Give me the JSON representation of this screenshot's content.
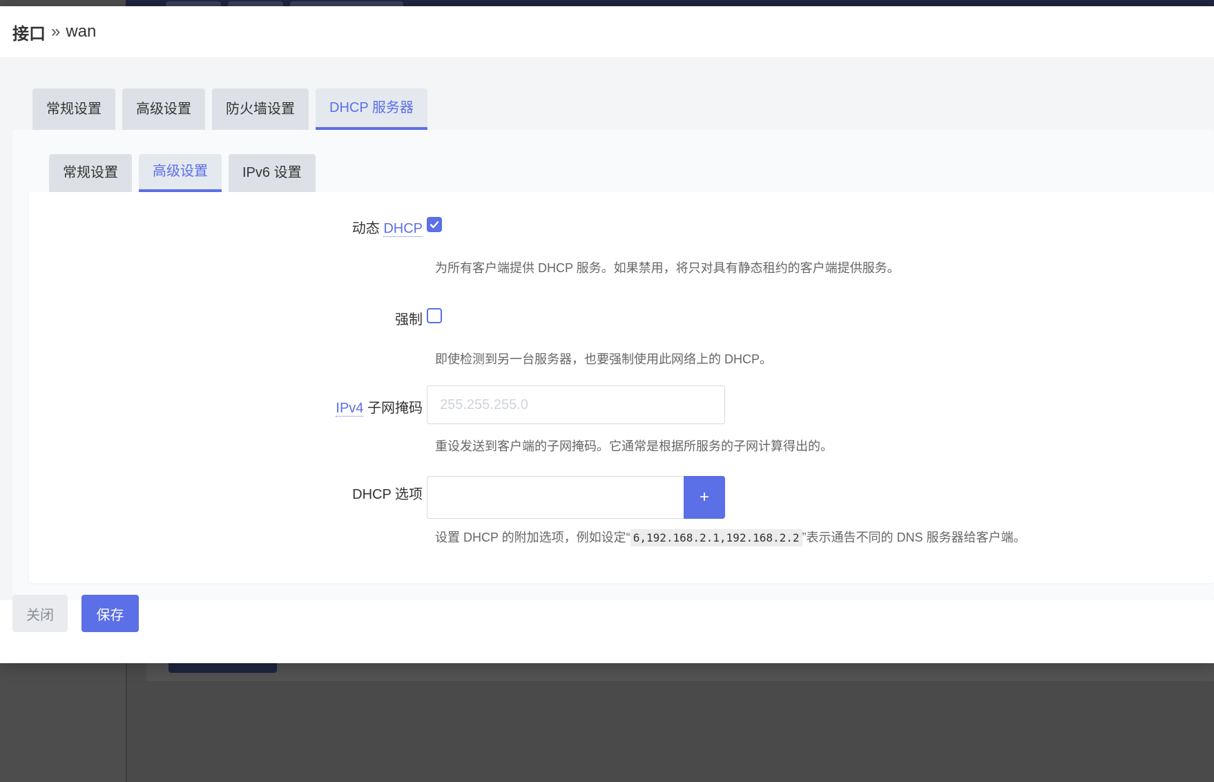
{
  "header": {
    "breadcrumb_root": "接口",
    "breadcrumb_sep": "»",
    "breadcrumb_current": "wan"
  },
  "outer_tabs": [
    {
      "label": "常规设置",
      "active": false
    },
    {
      "label": "高级设置",
      "active": false
    },
    {
      "label": "防火墙设置",
      "active": false
    },
    {
      "label": "DHCP 服务器",
      "active": true
    }
  ],
  "inner_tabs": [
    {
      "label": "常规设置",
      "active": false
    },
    {
      "label": "高级设置",
      "active": true
    },
    {
      "label": "IPv6 设置",
      "active": false
    }
  ],
  "fields": {
    "dynamic_dhcp": {
      "label_prefix": "动态",
      "label_abbr": "DHCP",
      "checked": true,
      "description": "为所有客户端提供 DHCP 服务。如果禁用，将只对具有静态租约的客户端提供服务。"
    },
    "force": {
      "label": "强制",
      "checked": false,
      "description": "即使检测到另一台服务器，也要强制使用此网络上的 DHCP。"
    },
    "netmask": {
      "label_abbr": "IPv4",
      "label_suffix": "子网掩码",
      "value": "",
      "placeholder": "255.255.255.0",
      "description": "重设发送到客户端的子网掩码。它通常是根据所服务的子网计算得出的。"
    },
    "dhcp_options": {
      "label": "DHCP 选项",
      "value": "",
      "add_label": "+",
      "description_before": "设置 DHCP 的附加选项，例如设定“",
      "description_code": "6,192.168.2.1,192.168.2.2",
      "description_after": "”表示通告不同的 DNS 服务器给客户端。"
    }
  },
  "footer": {
    "close_label": "关闭",
    "save_label": "保存"
  },
  "colors": {
    "accent": "#5b6fe6",
    "tab_bg": "#dde1e7",
    "overlay_bg": "#4a4a4a",
    "topbar": "#1f2540"
  }
}
